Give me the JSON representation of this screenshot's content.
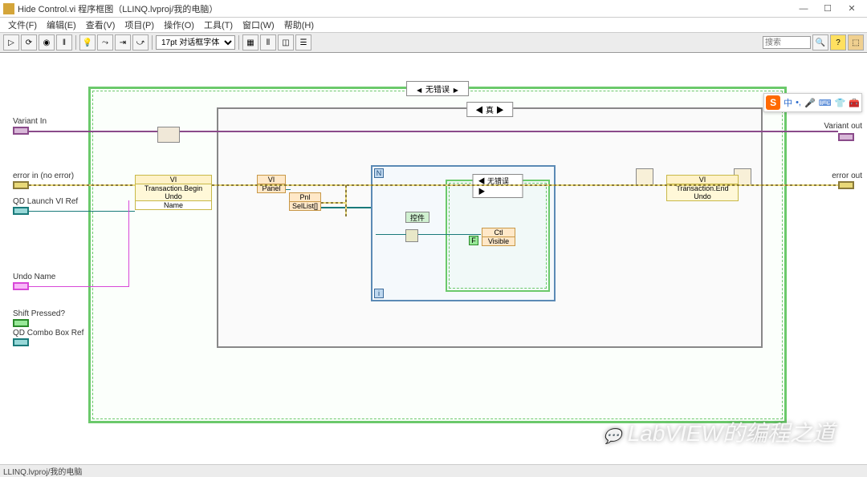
{
  "window": {
    "title": "Hide Control.vi 程序框图（LLINQ.lvproj/我的电脑）"
  },
  "menu": {
    "items": [
      "文件(F)",
      "编辑(E)",
      "查看(V)",
      "项目(P)",
      "操作(O)",
      "工具(T)",
      "窗口(W)",
      "帮助(H)"
    ]
  },
  "toolbar": {
    "font": "17pt 对话框字体",
    "search_placeholder": "搜索"
  },
  "terminals": {
    "variant_in": "Variant In",
    "error_in": "error in (no error)",
    "qd_ref": "QD Launch VI Ref",
    "undo_name": "Undo Name",
    "shift": "Shift Pressed?",
    "combo_ref": "QD Combo Box Ref",
    "variant_out": "Variant out",
    "error_out": "error out"
  },
  "cases": {
    "outer": "无错误",
    "inner": "真",
    "ctl": "无错误"
  },
  "nodes": {
    "vi_head": "VI",
    "begin_undo": "Transaction.Begin Undo",
    "name": "Name",
    "vi2": "VI",
    "panel": "Panel",
    "pnl": "Pnl",
    "sellist": "SelList[]",
    "kongjian": "控件",
    "ctl": "Ctl",
    "visible": "Visible",
    "vi_end_head": "VI",
    "end_undo": "Transaction.End Undo"
  },
  "status": {
    "path": "LLINQ.lvproj/我的电脑"
  },
  "watermark": "LabVIEW的编程之道",
  "ime": {
    "logo": "S",
    "zhong": "中"
  }
}
